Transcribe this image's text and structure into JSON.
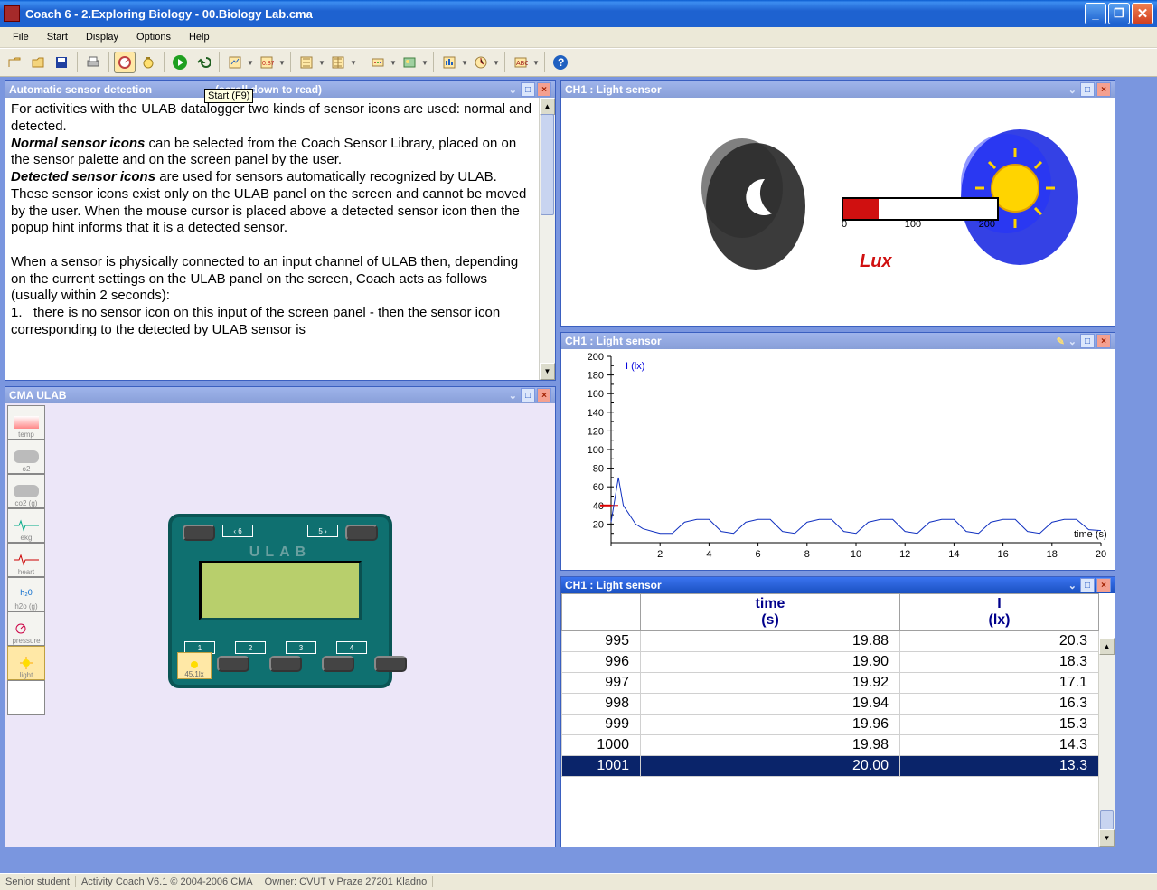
{
  "window": {
    "title": "Coach 6 - 2.Exploring Biology - 00.Biology Lab.cma"
  },
  "menu": [
    "File",
    "Start",
    "Display",
    "Options",
    "Help"
  ],
  "tooltip": "Start (F9)",
  "panel_text": {
    "title": "Automatic sensor detection",
    "title_suffix": "(scroll down to read)",
    "p1a": "For activities with the ULAB datalogger two kinds of sensor icons are used: normal and detected.",
    "p2a": "Normal sensor icons",
    "p2b": " can be selected from the Coach Sensor Library, placed on on the sensor palette and on the screen panel by the user.",
    "p3a": "Detected sensor icons",
    "p3b": " are used for sensors automatically recognized by ULAB. These sensor icons exist only on the ULAB panel on the screen and cannot be moved by the user. When the mouse cursor is placed above a detected sensor icon then the popup hint informs that it is a detected sensor.",
    "p4": "When a sensor is physically connected to an input channel of ULAB then, depending on the current settings on the ULAB panel on the screen, Coach acts as follows (usually within 2 seconds):",
    "li1": "there is no sensor icon on this input of the screen panel - then the sensor icon corresponding to the detected by ULAB sensor is"
  },
  "panel_ulab": {
    "title": "CMA ULAB",
    "brand": "ULAB",
    "sensors": [
      "temp",
      "o2",
      "co2 (g)",
      "ekg",
      "heart",
      "h2o (g)",
      "pressure",
      "light"
    ],
    "ports_top": [
      "‹ 6",
      "5 ›"
    ],
    "ports_bot": [
      "1",
      "2",
      "3",
      "4"
    ],
    "attached_sensor": "45.1lx"
  },
  "panel_light": {
    "title": "CH1 : Light sensor",
    "unit_label": "Lux",
    "ticks": [
      "0",
      "100",
      "200"
    ],
    "fill_pct": 23
  },
  "panel_chart": {
    "title": "CH1 : Light sensor"
  },
  "panel_table": {
    "title": "CH1 : Light sensor",
    "headers": {
      "idx": "",
      "time": "time\n(s)",
      "val": "I\n(lx)"
    }
  },
  "statusbar": [
    "Senior student",
    "Activity Coach V6.1 © 2004-2006 CMA",
    "Owner: CVUT v Praze 27201 Kladno"
  ],
  "chart_data": {
    "type": "line",
    "title": "",
    "xlabel": "time (s)",
    "ylabel": "I (lx)",
    "xlim": [
      0,
      20
    ],
    "ylim": [
      0,
      200
    ],
    "yticks": [
      0,
      20,
      40,
      60,
      80,
      100,
      120,
      140,
      160,
      180,
      200
    ],
    "xticks": [
      0,
      2,
      4,
      6,
      8,
      10,
      12,
      14,
      16,
      18,
      20
    ],
    "red_hline": 40,
    "series": [
      {
        "name": "I (lx)",
        "x": [
          0.0,
          0.3,
          0.5,
          0.8,
          1.0,
          1.3,
          1.7,
          2.0,
          2.5,
          3.0,
          3.5,
          4.0,
          4.5,
          5.0,
          5.5,
          6.0,
          6.5,
          7.0,
          7.5,
          8.0,
          8.5,
          9.0,
          9.5,
          10.0,
          10.5,
          11.0,
          11.5,
          12.0,
          12.5,
          13.0,
          13.5,
          14.0,
          14.5,
          15.0,
          15.5,
          16.0,
          16.5,
          17.0,
          17.5,
          18.0,
          18.5,
          19.0,
          19.5,
          20.0
        ],
        "y": [
          22,
          70,
          40,
          28,
          20,
          15,
          12,
          10,
          10,
          22,
          25,
          25,
          12,
          10,
          22,
          25,
          25,
          12,
          10,
          22,
          25,
          25,
          12,
          10,
          22,
          25,
          25,
          12,
          10,
          22,
          25,
          25,
          12,
          10,
          22,
          25,
          25,
          12,
          10,
          22,
          25,
          25,
          14,
          13
        ]
      }
    ]
  },
  "table_rows": [
    {
      "idx": 995,
      "time": 19.88,
      "val": 20.3
    },
    {
      "idx": 996,
      "time": 19.9,
      "val": 18.3
    },
    {
      "idx": 997,
      "time": 19.92,
      "val": 17.1
    },
    {
      "idx": 998,
      "time": 19.94,
      "val": 16.3
    },
    {
      "idx": 999,
      "time": 19.96,
      "val": 15.3
    },
    {
      "idx": 1000,
      "time": 19.98,
      "val": 14.3
    },
    {
      "idx": 1001,
      "time": 20.0,
      "val": 13.3
    }
  ]
}
